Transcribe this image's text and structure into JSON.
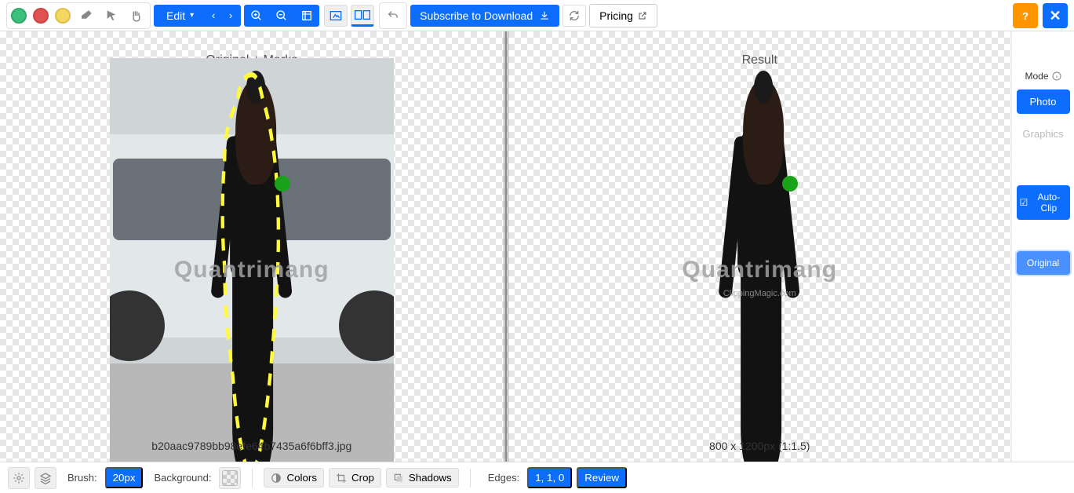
{
  "toolbar": {
    "edit_label": "Edit",
    "subscribe_label": "Subscribe to Download",
    "pricing_label": "Pricing"
  },
  "panels": {
    "left_title": "Original + Marks",
    "right_title": "Result",
    "left_footer": "b20aac9789bb98efe64b7435a6f6bff3.jpg",
    "right_footer": "800 x 1200px (1:1.5)"
  },
  "watermark": {
    "text": "Quantrimang",
    "sub": "ClippingMagic.com"
  },
  "sidepanel": {
    "mode_label": "Mode",
    "photo_label": "Photo",
    "graphics_label": "Graphics",
    "autoclip_label": "Auto-Clip",
    "original_label": "Original"
  },
  "bottombar": {
    "brush_label": "Brush:",
    "brush_value": "20px",
    "background_label": "Background:",
    "colors_label": "Colors",
    "crop_label": "Crop",
    "shadows_label": "Shadows",
    "edges_label": "Edges:",
    "edges_value": "1, 1, 0",
    "review_label": "Review"
  },
  "topright": {
    "help_label": "?",
    "close_label": "✕"
  },
  "icons": {
    "add": "add-mark",
    "remove": "remove-mark",
    "hair": "hair-tool",
    "eraser": "eraser-tool",
    "pointer": "pointer-tool",
    "pan": "pan-tool",
    "prev": "prev",
    "next": "next",
    "zoom_in": "zoom-in",
    "zoom_out": "zoom-out",
    "fit": "fit",
    "view_single": "single-view",
    "view_split": "split-view",
    "undo": "undo",
    "refresh": "refresh",
    "download": "download",
    "external": "external",
    "info": "info",
    "check": "check",
    "gear": "gear",
    "layers": "layers",
    "contrast": "contrast",
    "crop": "crop-icon",
    "shadow": "shadow-icon"
  }
}
